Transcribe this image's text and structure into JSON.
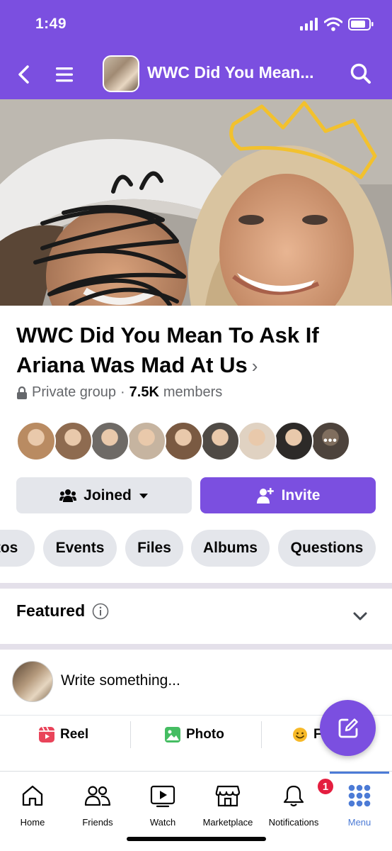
{
  "status_bar": {
    "time": "1:49"
  },
  "nav": {
    "title": "WWC Did You Mean..."
  },
  "group": {
    "name": "WWC Did You Mean To Ask If Ariana Was Mad At Us",
    "privacy": "Private group",
    "separator": "·",
    "member_count": "7.5K",
    "members_label": "members"
  },
  "member_avatars": [
    {
      "color": "#b98b62"
    },
    {
      "color": "#8e6b50"
    },
    {
      "color": "#6e6a66"
    },
    {
      "color": "#c6b4a0"
    },
    {
      "color": "#7a5a42"
    },
    {
      "color": "#4f4a45"
    },
    {
      "color": "#e0d2c2"
    },
    {
      "color": "#2d2a28"
    },
    {
      "color": "#8c7b6e"
    }
  ],
  "more_members_glyph": "•••",
  "buttons": {
    "joined": "Joined",
    "invite": "Invite"
  },
  "pills": [
    "tos",
    "Events",
    "Files",
    "Albums",
    "Questions"
  ],
  "featured": {
    "label": "Featured"
  },
  "composer": {
    "placeholder": "Write something..."
  },
  "media": {
    "reel": "Reel",
    "photo": "Photo",
    "feeling": "F"
  },
  "tabs": [
    {
      "label": "Home",
      "icon": "home-icon"
    },
    {
      "label": "Friends",
      "icon": "friends-icon"
    },
    {
      "label": "Watch",
      "icon": "watch-icon"
    },
    {
      "label": "Marketplace",
      "icon": "marketplace-icon"
    },
    {
      "label": "Notifications",
      "icon": "bell-icon",
      "badge": "1"
    },
    {
      "label": "Menu",
      "icon": "menu-grid-icon",
      "active": true
    }
  ],
  "colors": {
    "accent": "#7b4fe0",
    "tab_active": "#4c7bd6",
    "badge": "#e41e3f"
  }
}
